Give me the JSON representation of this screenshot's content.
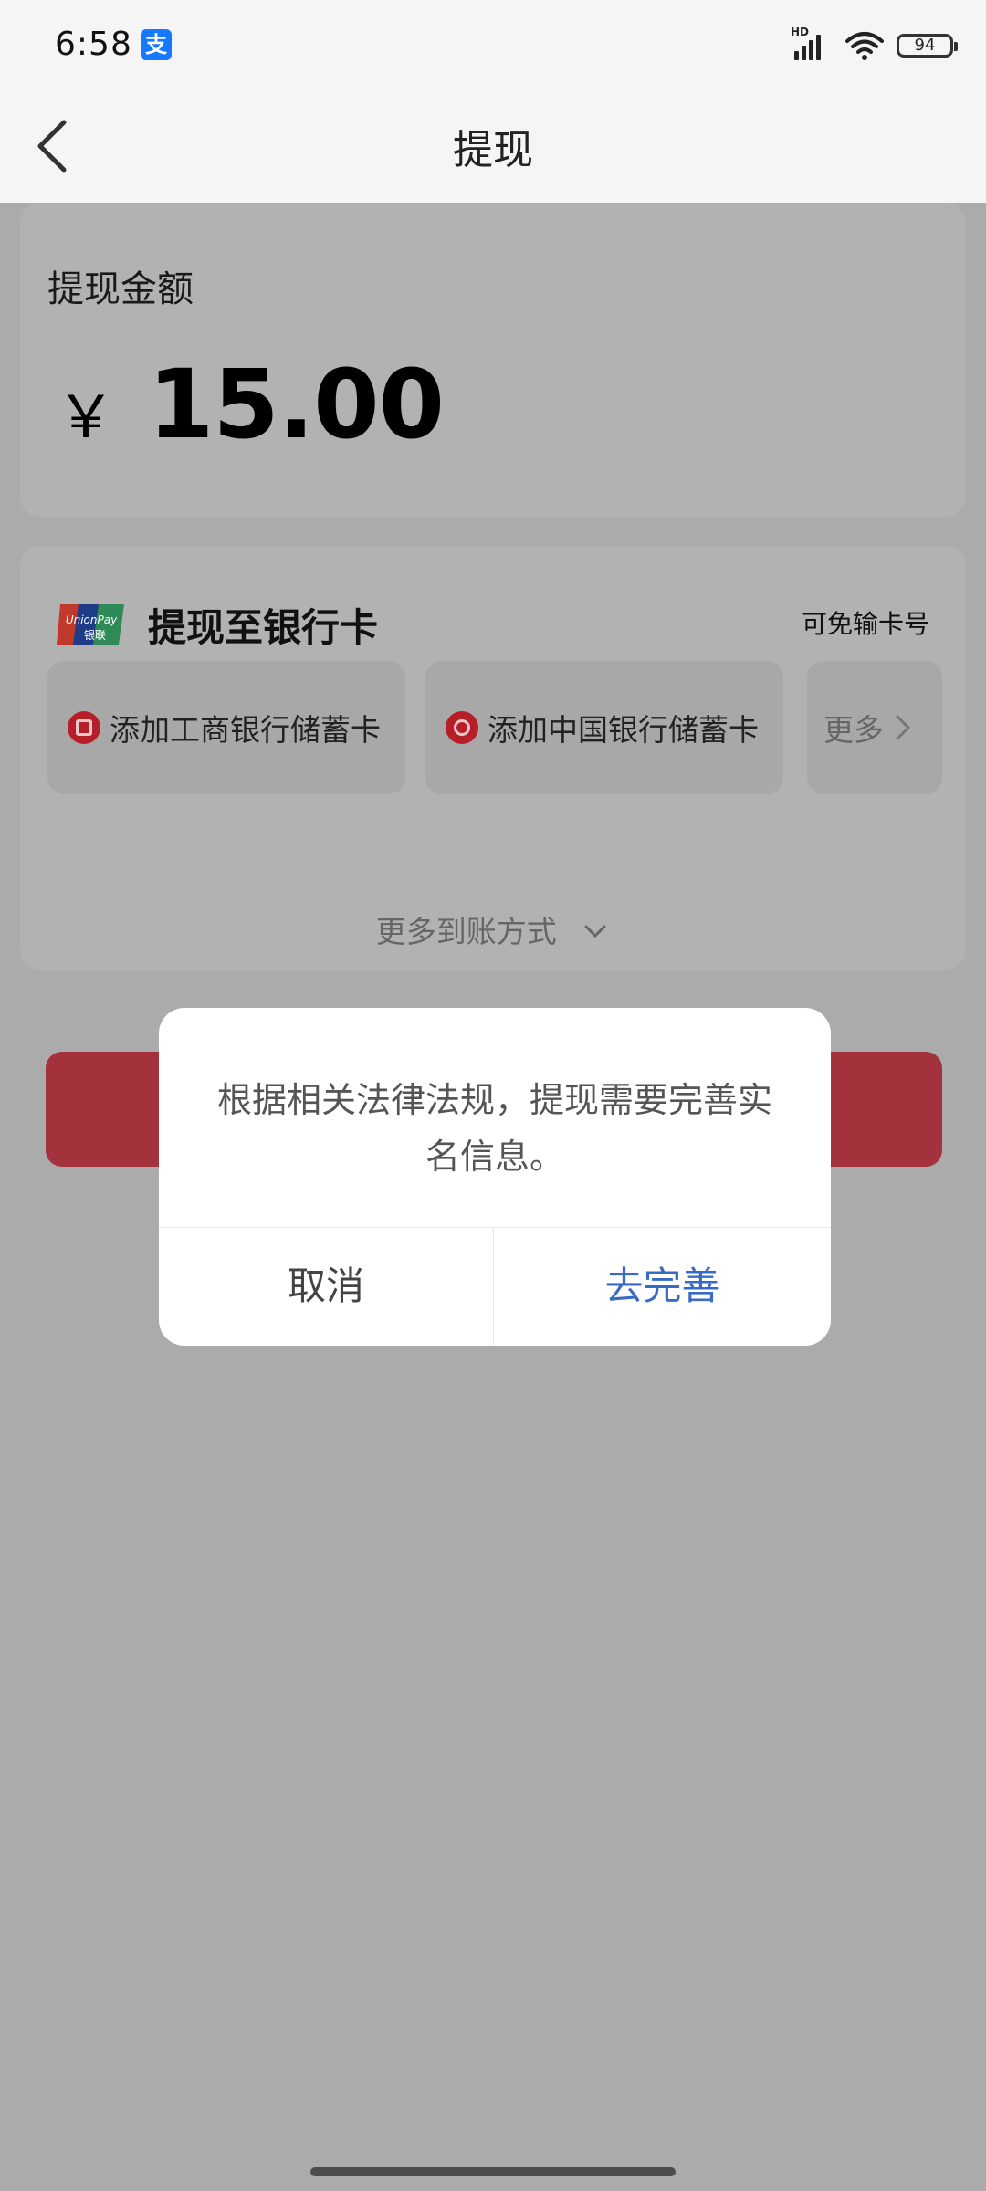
{
  "status_bar": {
    "time": "6:58",
    "alipay_badge": "支",
    "battery": "94",
    "network": "HD"
  },
  "nav": {
    "title": "提现"
  },
  "amount": {
    "label": "提现金额",
    "currency": "￥",
    "value": "15.00"
  },
  "bank": {
    "title": "提现至银行卡",
    "no_card_hint": "可免输卡号",
    "options": [
      "添加工商银行储蓄卡",
      "添加中国银行储蓄卡",
      "更多"
    ],
    "more_ways": "更多到账方式"
  },
  "dialog": {
    "message": "根据相关法律法规，提现需要完善实名信息。",
    "cancel": "取消",
    "confirm": "去完善"
  },
  "colors": {
    "accent": "#3a6bc3",
    "button": "#a3323c",
    "bank_icon": "#b61f2a"
  }
}
